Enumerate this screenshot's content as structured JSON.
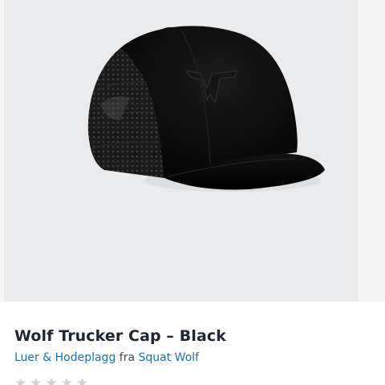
{
  "product": {
    "title": "Wolf Trucker Cap – Black",
    "category_link": "Luer & Hodeplagg",
    "from_word": "fra",
    "brand_link": "Squat Wolf",
    "image_icon": "trucker-cap-photo",
    "rating_icon": "star-icon"
  },
  "colors": {
    "background": "#eaebed",
    "title": "#1d2733",
    "link": "#1a73a8"
  }
}
